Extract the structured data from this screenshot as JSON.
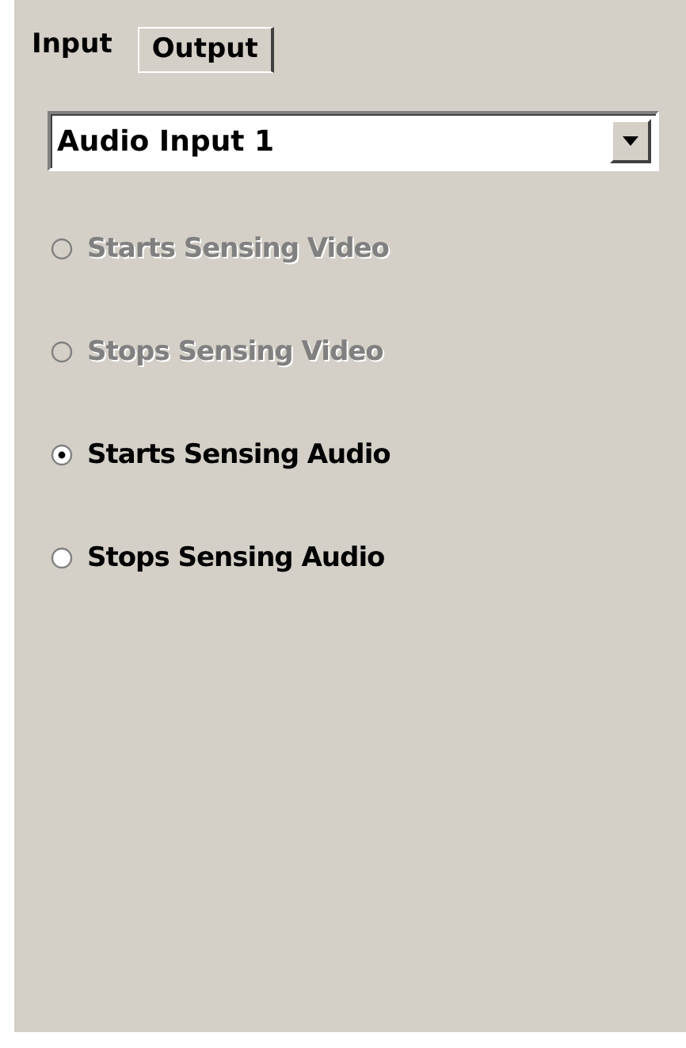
{
  "tabs": [
    {
      "label": "Input",
      "selected": true
    },
    {
      "label": "Output",
      "selected": false
    }
  ],
  "source_dropdown": {
    "value": "Audio Input 1"
  },
  "options": [
    {
      "label": "Starts Sensing Video",
      "selected": false,
      "disabled": true
    },
    {
      "label": "Stops Sensing Video",
      "selected": false,
      "disabled": true
    },
    {
      "label": "Starts Sensing Audio",
      "selected": true,
      "disabled": false
    },
    {
      "label": "Stops Sensing Audio",
      "selected": false,
      "disabled": false
    }
  ]
}
